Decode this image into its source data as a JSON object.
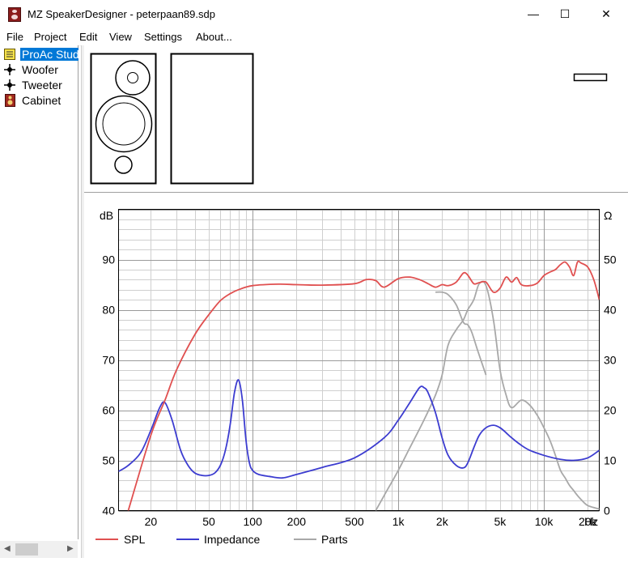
{
  "window": {
    "title": "MZ SpeakerDesigner - peterpaan89.sdp",
    "minimize": "—",
    "maximize": "☐",
    "close": "✕"
  },
  "menu": [
    "File",
    "Project",
    "Edit",
    "View",
    "Settings",
    "About..."
  ],
  "tree": {
    "items": [
      {
        "label": "ProAc Studio",
        "icon": "project-icon",
        "selected": true
      },
      {
        "label": "Woofer",
        "icon": "driver-icon",
        "selected": false
      },
      {
        "label": "Tweeter",
        "icon": "driver-icon",
        "selected": false
      },
      {
        "label": "Cabinet",
        "icon": "cabinet-icon",
        "selected": false
      }
    ]
  },
  "colors": {
    "spl": "#e05050",
    "impedance": "#3c3cd0",
    "parts": "#a8a8a8",
    "selection": "#0078d7"
  },
  "chart_data": {
    "type": "line",
    "x_scale": "log",
    "xlim": [
      12,
      24000
    ],
    "xticks": [
      {
        "v": 20,
        "t": "20"
      },
      {
        "v": 50,
        "t": "50"
      },
      {
        "v": 100,
        "t": "100"
      },
      {
        "v": 200,
        "t": "200"
      },
      {
        "v": 500,
        "t": "500"
      },
      {
        "v": 1000,
        "t": "1k"
      },
      {
        "v": 2000,
        "t": "2k"
      },
      {
        "v": 5000,
        "t": "5k"
      },
      {
        "v": 10000,
        "t": "10k"
      },
      {
        "v": 20000,
        "t": "20k"
      }
    ],
    "x_unit": "Hz",
    "ylabel_left": "dB",
    "ylim_left": [
      40,
      100
    ],
    "yticks_left": [
      40,
      50,
      60,
      70,
      80,
      90
    ],
    "ylabel_right": "Ω",
    "ylim_right": [
      0,
      60
    ],
    "yticks_right": [
      0,
      10,
      20,
      30,
      40,
      50
    ],
    "grid": true,
    "legend_position": "bottom",
    "series": [
      {
        "name": "SPL",
        "axis": "left",
        "color": "#e05050",
        "x": [
          14,
          20,
          25,
          30,
          40,
          50,
          60,
          70,
          80,
          100,
          150,
          200,
          300,
          500,
          600,
          700,
          800,
          1000,
          1200,
          1400,
          1600,
          1800,
          2000,
          2200,
          2500,
          2800,
          3000,
          3300,
          3600,
          4000,
          4500,
          5000,
          5500,
          6000,
          6500,
          7000,
          8000,
          9000,
          10000,
          11000,
          12000,
          13000,
          14000,
          15000,
          16000,
          17000,
          18000,
          20000,
          22000,
          24000
        ],
        "y": [
          40,
          55,
          62,
          68,
          75,
          79,
          81.8,
          83.2,
          84,
          84.8,
          85.1,
          85,
          84.9,
          85.2,
          86,
          85.8,
          84.5,
          86.2,
          86.5,
          86,
          85.2,
          84.5,
          85,
          84.8,
          85.5,
          87.3,
          86.9,
          85.2,
          85.4,
          85.5,
          83.5,
          84.3,
          86.5,
          85.5,
          86.4,
          85,
          84.8,
          85.3,
          86.8,
          87.5,
          88,
          89,
          89.5,
          88.5,
          86.8,
          89.5,
          89.3,
          88.5,
          86,
          82
        ]
      },
      {
        "name": "Impedance",
        "axis": "right",
        "color": "#3c3cd0",
        "x": [
          12,
          14,
          17,
          20,
          23,
          25,
          28,
          32,
          36,
          40,
          45,
          50,
          55,
          60,
          65,
          70,
          75,
          80,
          85,
          90,
          95,
          100,
          110,
          130,
          160,
          200,
          300,
          500,
          800,
          1000,
          1200,
          1400,
          1500,
          1600,
          1800,
          2000,
          2200,
          2500,
          2800,
          3000,
          3300,
          3600,
          4000,
          4500,
          5000,
          5500,
          6000,
          7000,
          8000,
          10000,
          13000,
          16000,
          20000,
          24000
        ],
        "y": [
          7.8,
          9,
          11.5,
          16,
          20.5,
          21.5,
          18,
          12,
          9,
          7.5,
          7,
          7,
          7.5,
          9,
          12,
          17,
          23.5,
          26,
          22,
          14,
          9.5,
          8,
          7.2,
          6.8,
          6.5,
          7.2,
          8.6,
          10.5,
          14.5,
          18,
          21.5,
          24.5,
          24.5,
          23.5,
          19.5,
          14.5,
          11,
          9,
          8.5,
          9.5,
          12.5,
          15,
          16.5,
          17,
          16.5,
          15.5,
          14.5,
          13,
          12,
          11,
          10.2,
          10,
          10.5,
          12
        ]
      },
      {
        "name": "Parts",
        "axis": "right",
        "color": "#a8a8a8",
        "x": [
          700,
          800,
          1000,
          1200,
          1500,
          1800,
          2000,
          2200,
          2500,
          2800,
          3000,
          3300,
          3600,
          4000,
          4500,
          5000,
          5500,
          6000,
          7000,
          8000,
          9000,
          10000,
          11000,
          12000,
          13000,
          14000,
          15000,
          16000,
          17000,
          18000,
          19000,
          20000,
          22000,
          24000
        ],
        "y": [
          0,
          3,
          8,
          12.5,
          18,
          23,
          27,
          33,
          36,
          38,
          40,
          42,
          45.2,
          44.8,
          38,
          28,
          23,
          20.5,
          22,
          21,
          19,
          16.5,
          14,
          11,
          8,
          6.5,
          5,
          4,
          3,
          2.2,
          1.5,
          1,
          0.6,
          0.3
        ],
        "x2": [
          1800,
          2000,
          2200,
          2500,
          2800,
          3000,
          3200,
          3500,
          4000
        ],
        "y2": [
          43.5,
          43.5,
          43,
          41,
          37.5,
          37,
          35.5,
          32,
          27
        ]
      }
    ]
  }
}
